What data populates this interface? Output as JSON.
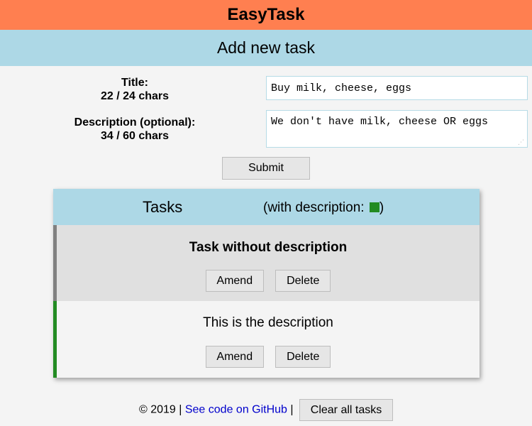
{
  "app": {
    "title": "EasyTask",
    "header_color": "#ff7f50"
  },
  "add_task": {
    "heading": "Add new task",
    "title_label": "Title:",
    "title_count": "22 / 24 chars",
    "title_value": "Buy milk, cheese, eggs",
    "description_label": "Description (optional):",
    "description_count": "34 / 60 chars",
    "description_value": "We don't have milk, cheese OR eggs",
    "submit_label": "Submit"
  },
  "tasks": {
    "heading": "Tasks",
    "legend_text": "(with description:",
    "legend_close": ")",
    "description_color": "#228b22",
    "items": [
      {
        "text": "Task without description",
        "amend_label": "Amend",
        "delete_label": "Delete",
        "has_description": false
      },
      {
        "text": "This is the description",
        "amend_label": "Amend",
        "delete_label": "Delete",
        "has_description": true
      }
    ]
  },
  "footer": {
    "copyright": "© 2019 |",
    "github_link": "See code on GitHub",
    "separator": "|",
    "clear_label": "Clear all tasks"
  },
  "colors": {
    "accent_blue": "#add8e6",
    "header_orange": "#ff7f50",
    "description_green": "#228b22"
  }
}
